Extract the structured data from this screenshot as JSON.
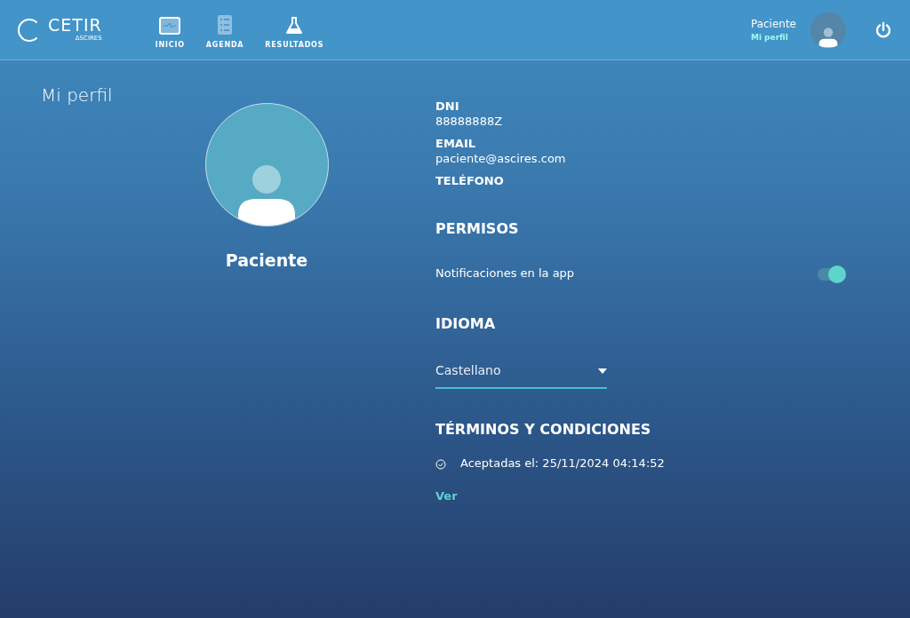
{
  "header": {
    "logo": {
      "name": "CETIR",
      "subtitle": "ΔSCIRES"
    },
    "nav": [
      {
        "label": "INICIO",
        "kind": "monitor"
      },
      {
        "label": "AGENDA",
        "kind": "list"
      },
      {
        "label": "RESULTADOS",
        "kind": "flask"
      }
    ],
    "user": {
      "name": "Paciente",
      "link": "Mi perfil"
    }
  },
  "page_title": "Mi perfil",
  "profile": {
    "name": "Paciente"
  },
  "fields": [
    {
      "label": "DNI",
      "value": "88888888Z"
    },
    {
      "label": "EMAIL",
      "value": "paciente@ascires.com"
    },
    {
      "label": "TELÉFONO"
    }
  ],
  "permissions": {
    "title": "PERMISOS",
    "items": [
      {
        "label": "Notificaciones en la app",
        "on": true
      }
    ]
  },
  "language": {
    "title": "IDIOMA",
    "value": "Castellano"
  },
  "terms": {
    "title": "TÉRMINOS Y CONDICIONES",
    "accepted": "Aceptadas el: 25/11/2024 04:14:52",
    "link": "Ver"
  }
}
